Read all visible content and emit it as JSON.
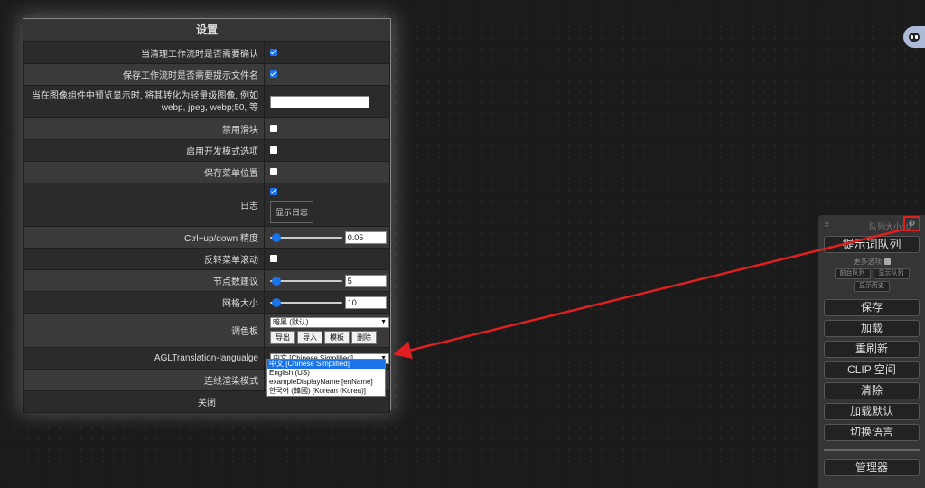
{
  "dialog": {
    "title": "设置",
    "rows": {
      "confirm_clear": "当清理工作流时是否需要确认",
      "prompt_filename": "保存工作流时是否需要提示文件名",
      "preview_format": "当在图像组件中预览显示时, 将其转化为轻量级图像, 例如 webp, jpeg, webp;50, 等",
      "disable_slider": "禁用滑块",
      "dev_mode": "启用开发模式选项",
      "save_menu_pos": "保存菜单位置",
      "log": "日志",
      "show_log": "显示日志",
      "ctrl_precision": "Ctrl+up/down 精度",
      "ctrl_precision_value": "0.05",
      "invert_scroll": "反转菜单滚动",
      "node_suggest": "节点数建议",
      "node_suggest_value": "5",
      "grid_size": "网格大小",
      "grid_size_value": "10",
      "palette": "调色板",
      "palette_selected": "暗黑 (默认)",
      "palette_export": "导出",
      "palette_import": "导入",
      "palette_template": "模板",
      "palette_delete": "删除",
      "agl_language": "AGLTranslation-langualge",
      "agl_selected": "中文 [Chinese Simplified]",
      "link_render": "连线渲染模式",
      "close": "关闭"
    },
    "language_options": [
      "中文 [Chinese Simplified]",
      "English (US)",
      "exampleDisplayName [enName]",
      "한국어 (韓國) [Korean (Korea)]"
    ]
  },
  "queue_panel": {
    "title": "队列大小: 0",
    "queue_prompt": "提示词队列",
    "more_options": "更多选项",
    "view_queue_left": "前台队列",
    "view_queue": "显示队列",
    "view_history": "显示历史",
    "save": "保存",
    "load": "加载",
    "refresh": "重刷新",
    "clipspace": "CLIP 空间",
    "clear": "清除",
    "load_default": "加载默认",
    "switch_lang": "切换语言",
    "manager": "管理器"
  },
  "colors": {
    "highlight": "#e02020",
    "accent": "#1a73e8"
  }
}
